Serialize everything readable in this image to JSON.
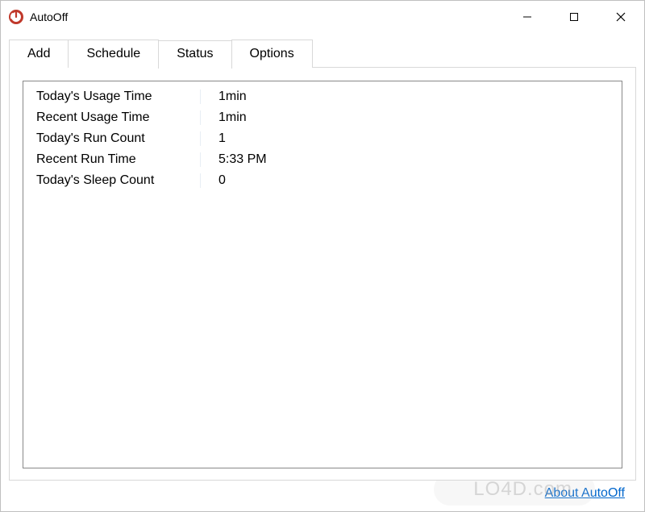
{
  "title": "AutoOff",
  "tabs": {
    "add": "Add",
    "schedule": "Schedule",
    "status": "Status",
    "options": "Options"
  },
  "status": {
    "rows": [
      {
        "label": "Today's Usage Time",
        "value": "1min"
      },
      {
        "label": "Recent Usage Time",
        "value": "1min"
      },
      {
        "label": "Today's Run Count",
        "value": "1"
      },
      {
        "label": "Recent Run Time",
        "value": "5:33 PM"
      },
      {
        "label": "Today's Sleep Count",
        "value": "0"
      }
    ]
  },
  "footer": {
    "about_link": "About AutoOff"
  },
  "watermark": "LO4D.com"
}
